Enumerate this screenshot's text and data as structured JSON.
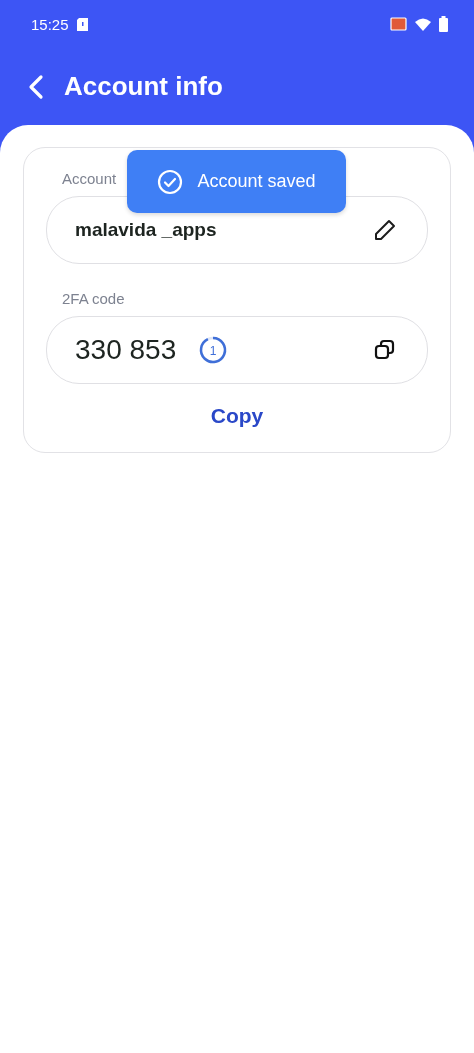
{
  "status_bar": {
    "time": "15:25"
  },
  "header": {
    "title": "Account info"
  },
  "toast": {
    "text": "Account saved"
  },
  "account": {
    "label": "Account",
    "value": "malavida _apps"
  },
  "code": {
    "label": "2FA code",
    "value": "330 853",
    "timer": {
      "text": "1",
      "level": 0.93
    }
  },
  "copy_button": {
    "label": "Copy"
  }
}
